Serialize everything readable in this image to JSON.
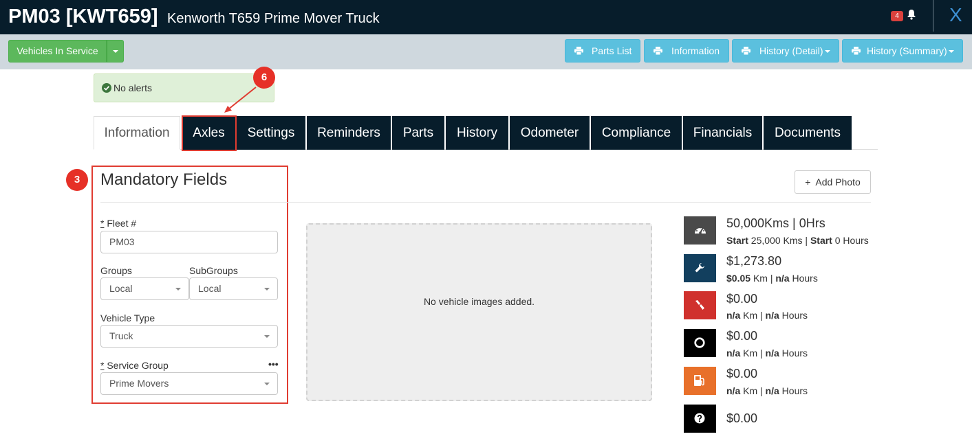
{
  "header": {
    "code": "PM03 [KWT659]",
    "description": "Kenworth T659 Prime Mover Truck",
    "notification_count": "4",
    "close_label": "X"
  },
  "toolbar": {
    "status_label": "Vehicles In Service",
    "parts_list_label": "Parts List",
    "information_label": "Information",
    "history_detail_label": "History (Detail)",
    "history_summary_label": "History (Summary)"
  },
  "alert": {
    "text": "No alerts"
  },
  "annotations": {
    "marker_6": "6",
    "marker_3": "3"
  },
  "tabs": [
    {
      "label": "Information",
      "active": true
    },
    {
      "label": "Axles",
      "active": false
    },
    {
      "label": "Settings",
      "active": false
    },
    {
      "label": "Reminders",
      "active": false
    },
    {
      "label": "Parts",
      "active": false
    },
    {
      "label": "History",
      "active": false
    },
    {
      "label": "Odometer",
      "active": false
    },
    {
      "label": "Compliance",
      "active": false
    },
    {
      "label": "Financials",
      "active": false
    },
    {
      "label": "Documents",
      "active": false
    }
  ],
  "mandatory": {
    "title": "Mandatory Fields",
    "required_mark": "*",
    "fleet_label": "Fleet #",
    "fleet_value": "PM03",
    "groups_label": "Groups",
    "groups_value": "Local",
    "subgroups_label": "SubGroups",
    "subgroups_value": "Local",
    "vehicle_type_label": "Vehicle Type",
    "vehicle_type_value": "Truck",
    "service_group_label": "Service Group",
    "service_group_value": "Prime Movers",
    "more_icon": "•••"
  },
  "photo": {
    "add_label": "Add Photo",
    "plus": "+",
    "empty_message": "No vehicle images added."
  },
  "stats": {
    "odometer": {
      "main": "50,000Kms | 0Hrs",
      "start_label_1": "Start",
      "start_km": "25,000 Kms |",
      "start_label_2": "Start",
      "start_hours": "0 Hours",
      "icon": "dashboard-icon",
      "color": "#4a4a4a"
    },
    "maintenance": {
      "main": "$1,273.80",
      "rate": "$0.05",
      "km_sep": "Km |",
      "hours_rate": "n/a",
      "hours_label": "Hours",
      "icon": "wrench-icon",
      "color": "#123f5e"
    },
    "repairs": {
      "main": "$0.00",
      "rate": "n/a",
      "km_sep": "Km |",
      "hours_rate": "n/a",
      "hours_label": "Hours",
      "icon": "screwdriver-icon",
      "color": "#d0312d"
    },
    "tyres": {
      "main": "$0.00",
      "rate": "n/a",
      "km_sep": "Km |",
      "hours_rate": "n/a",
      "hours_label": "Hours",
      "icon": "tyre-icon",
      "color": "#000000"
    },
    "fuel": {
      "main": "$0.00",
      "rate": "n/a",
      "km_sep": "Km |",
      "hours_rate": "n/a",
      "hours_label": "Hours",
      "icon": "fuel-pump-icon",
      "color": "#e8702a"
    },
    "other": {
      "main": "$0.00",
      "icon": "question-icon",
      "color": "#000000"
    }
  }
}
